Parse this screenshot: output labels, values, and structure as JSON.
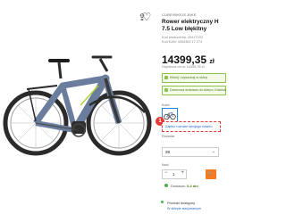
{
  "product": {
    "brand": "CUBE/BIKE/E-BIKE",
    "title_line1": "Rower elektryczny H",
    "title_line2": "7.5 Low błękitny",
    "meta_line1": "Kod producenta: 40417033",
    "meta_line2": "Kod EAN: 4054363 17 274",
    "price_main": "14399,35",
    "price_currency": "zł",
    "lowest_price": "Najniższa cena: 14399,35 zł"
  },
  "badges": {
    "badge1": "Kliknij i wyszukaj w sklep",
    "badge2": "Darmowa dostawa do sklepu Gdańsk"
  },
  "color": {
    "label": "Kolor"
  },
  "highlight": {
    "text": "Zapisz rozmiar swojego roweru",
    "marker": "1"
  },
  "size": {
    "label": "Rozmiar",
    "selected": "38",
    "chevron": "⌄"
  },
  "quantity": {
    "label": "Ilość",
    "minus": "−",
    "value": "1",
    "plus": "+",
    "cart_label": "🛒"
  },
  "delivery": {
    "text_prefix": "Dostawa: ",
    "text_days": "3-4 dni"
  },
  "store": {
    "title": "Produkt dostępny",
    "subtitle": "W sklepie stacjonarnym"
  },
  "icons": {
    "share": "⇪",
    "favorite": "♡"
  }
}
